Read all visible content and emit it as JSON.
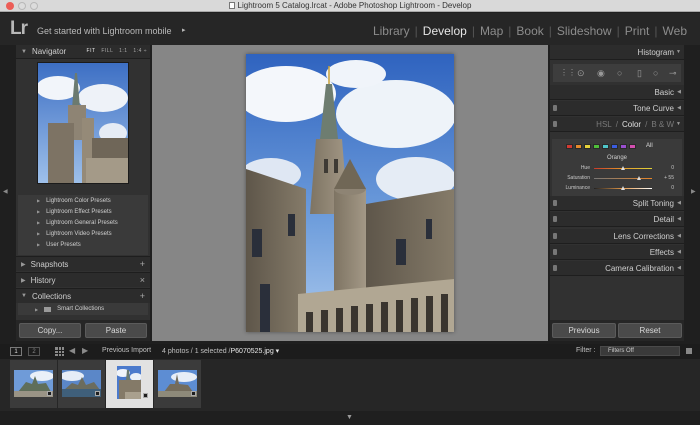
{
  "window": {
    "title": "Lightroom 5 Catalog.lrcat - Adobe Photoshop Lightroom - Develop"
  },
  "identity": {
    "logo": "Lr",
    "mobile_text": "Get started with Lightroom mobile",
    "mobile_arrow": "▸"
  },
  "modules": [
    {
      "label": "Library",
      "active": false
    },
    {
      "label": "Develop",
      "active": true
    },
    {
      "label": "Map",
      "active": false
    },
    {
      "label": "Book",
      "active": false
    },
    {
      "label": "Slideshow",
      "active": false
    },
    {
      "label": "Print",
      "active": false
    },
    {
      "label": "Web",
      "active": false
    }
  ],
  "left_panel": {
    "navigator": {
      "title": "Navigator",
      "zoom_options": [
        "FIT",
        "FILL",
        "1:1",
        "1:4 ÷"
      ],
      "selected_zoom": "FIT"
    },
    "presets": [
      "Lightroom Color Presets",
      "Lightroom Effect Presets",
      "Lightroom General Presets",
      "Lightroom Video Presets",
      "User Presets"
    ],
    "snapshots": {
      "title": "Snapshots",
      "action": "+"
    },
    "history": {
      "title": "History",
      "action": "×"
    },
    "collections": {
      "title": "Collections",
      "action": "+",
      "items": [
        "Smart Collections"
      ]
    },
    "copy_button": "Copy...",
    "paste_button": "Paste"
  },
  "right_panel": {
    "histogram": "Histogram",
    "basic": "Basic",
    "tone_curve": "Tone Curve",
    "hsl_tabs": [
      "HSL",
      "Color",
      "B & W"
    ],
    "hsl_separator": "/",
    "active_hsl_tab": "Color",
    "color_swatches": [
      "#d23a32",
      "#e58a2b",
      "#e5d23a",
      "#4fbf3a",
      "#4fc6c9",
      "#3a5ce0",
      "#9a4fd0",
      "#d44fb0"
    ],
    "swatch_all": "All",
    "selected_color": "Orange",
    "sliders": [
      {
        "label": "Hue",
        "value": "0",
        "position": 0.5
      },
      {
        "label": "Saturation",
        "value": "+ 55",
        "position": 0.77
      },
      {
        "label": "Luminance",
        "value": "0",
        "position": 0.5
      }
    ],
    "split_toning": "Split Toning",
    "detail": "Detail",
    "lens_corrections": "Lens Corrections",
    "effects": "Effects",
    "camera_calibration": "Camera Calibration",
    "previous_button": "Previous",
    "reset_button": "Reset"
  },
  "filmstrip": {
    "screen1": "1",
    "screen2": "2",
    "source": "Previous Import",
    "count_text": "4 photos / 1 selected /",
    "filename": "P6070525.jpg ▾",
    "filter_label": "Filter :",
    "filter_value": "Filters Off"
  },
  "colors": {
    "accent_panel": "#313131",
    "background": "#1f1f1f",
    "center_bg": "#868686"
  }
}
